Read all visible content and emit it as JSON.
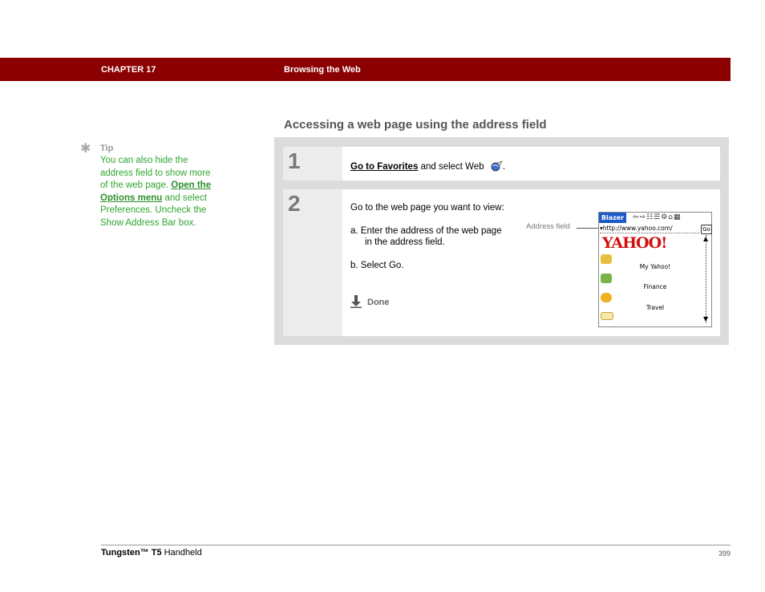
{
  "header": {
    "chapter": "CHAPTER 17",
    "title": "Browsing the Web"
  },
  "section": {
    "heading": "Accessing a web page using the address field"
  },
  "tip": {
    "icon": "asterisk-icon",
    "label": "Tip",
    "text_1": "You can also hide the address field to show more of the web page.",
    "link": "Open the Options menu",
    "text_2": "and select Preferences. Uncheck the Show Address Bar box."
  },
  "steps": [
    {
      "number": "1",
      "link": "Go to Favorites",
      "text": "and select Web",
      "icon": "web-globe-icon",
      "end": "."
    },
    {
      "number": "2",
      "intro": "Go to the web page you want to view:",
      "sub_a": "a.  Enter the address of the web page in the address field.",
      "sub_b": "b.  Select Go.",
      "done_label": "Done",
      "done_icon": "done-arrow-icon"
    }
  ],
  "screenshot": {
    "callout": "Address field",
    "browser_name": "Blazer",
    "toolbar_icons": "⇦⇨☷☰⚙⌂▦",
    "url": "▾http://www.yahoo.com/",
    "go_button": "Go",
    "logo": "YAHOO!",
    "items": [
      "My Yahoo!",
      "Finance",
      "Travel"
    ]
  },
  "footer": {
    "product_prefix": "Tungsten™ T5",
    "product_suffix": "Handheld",
    "page": "399"
  }
}
